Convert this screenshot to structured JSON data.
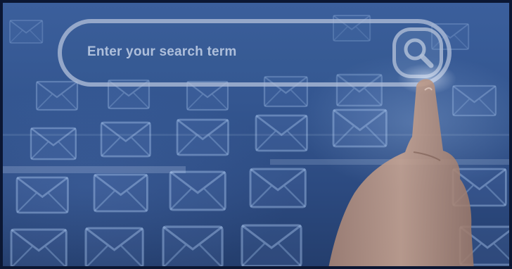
{
  "search": {
    "placeholder": "Enter your search term"
  },
  "icons": {
    "search_button": "search-icon",
    "background_tiles": "envelope-icon"
  },
  "colors": {
    "background": "#33558f",
    "frame": "#0b1733",
    "search_outline": "#afbed7",
    "skin": "#c9a490"
  }
}
